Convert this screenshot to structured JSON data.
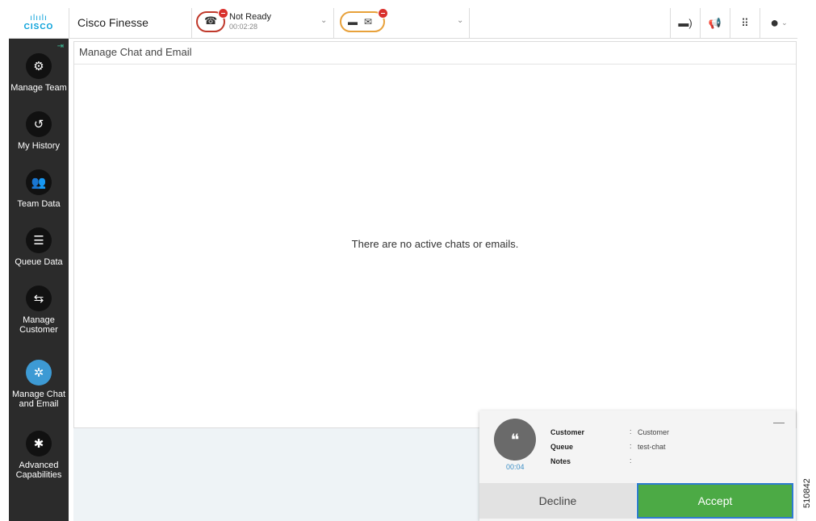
{
  "header": {
    "logo_bars": "ılıılı",
    "logo_word": "CISCO",
    "app_title": "Cisco Finesse",
    "voice_state_label": "Not Ready",
    "voice_state_timer": "00:02:28",
    "chevron": "⌄"
  },
  "icons": {
    "phone": "☎",
    "chat": "▬",
    "email": "✉",
    "announcement": "▬)",
    "megaphone": "📢",
    "dialpad": "⠿",
    "user": "●",
    "pin": "⇥"
  },
  "sidebar": {
    "items": [
      {
        "label": "Manage Team",
        "icon": "manage-team-icon",
        "glyph": "⚙"
      },
      {
        "label": "My History",
        "icon": "history-icon",
        "glyph": "↺"
      },
      {
        "label": "Team Data",
        "icon": "team-data-icon",
        "glyph": "👥"
      },
      {
        "label": "Queue Data",
        "icon": "queue-data-icon",
        "glyph": "☰"
      },
      {
        "label": "Manage\nCustomer",
        "icon": "manage-customer-icon",
        "glyph": "⇆"
      },
      {
        "label": "Manage Chat\nand Email",
        "icon": "gear-icon",
        "glyph": "✲"
      },
      {
        "label": "Advanced\nCapabilities",
        "icon": "advanced-capabilities-icon",
        "glyph": "✱"
      }
    ],
    "active_index": 5
  },
  "panel": {
    "title": "Manage Chat and Email",
    "empty_message": "There are no active chats or emails."
  },
  "toast": {
    "timer": "00:04",
    "minimize": "—",
    "fields": [
      {
        "key": "Customer",
        "sep": ":",
        "value": "Customer"
      },
      {
        "key": "Queue",
        "sep": ":",
        "value": "test-chat"
      },
      {
        "key": "Notes",
        "sep": ":",
        "value": ""
      }
    ],
    "decline_label": "Decline",
    "accept_label": "Accept"
  },
  "doc_id": "510842",
  "colors": {
    "accent_blue": "#3d9ad4",
    "accept_green": "#4caa45",
    "not_ready_red": "#d9302c",
    "sidebar_bg": "#2b2b2b"
  }
}
